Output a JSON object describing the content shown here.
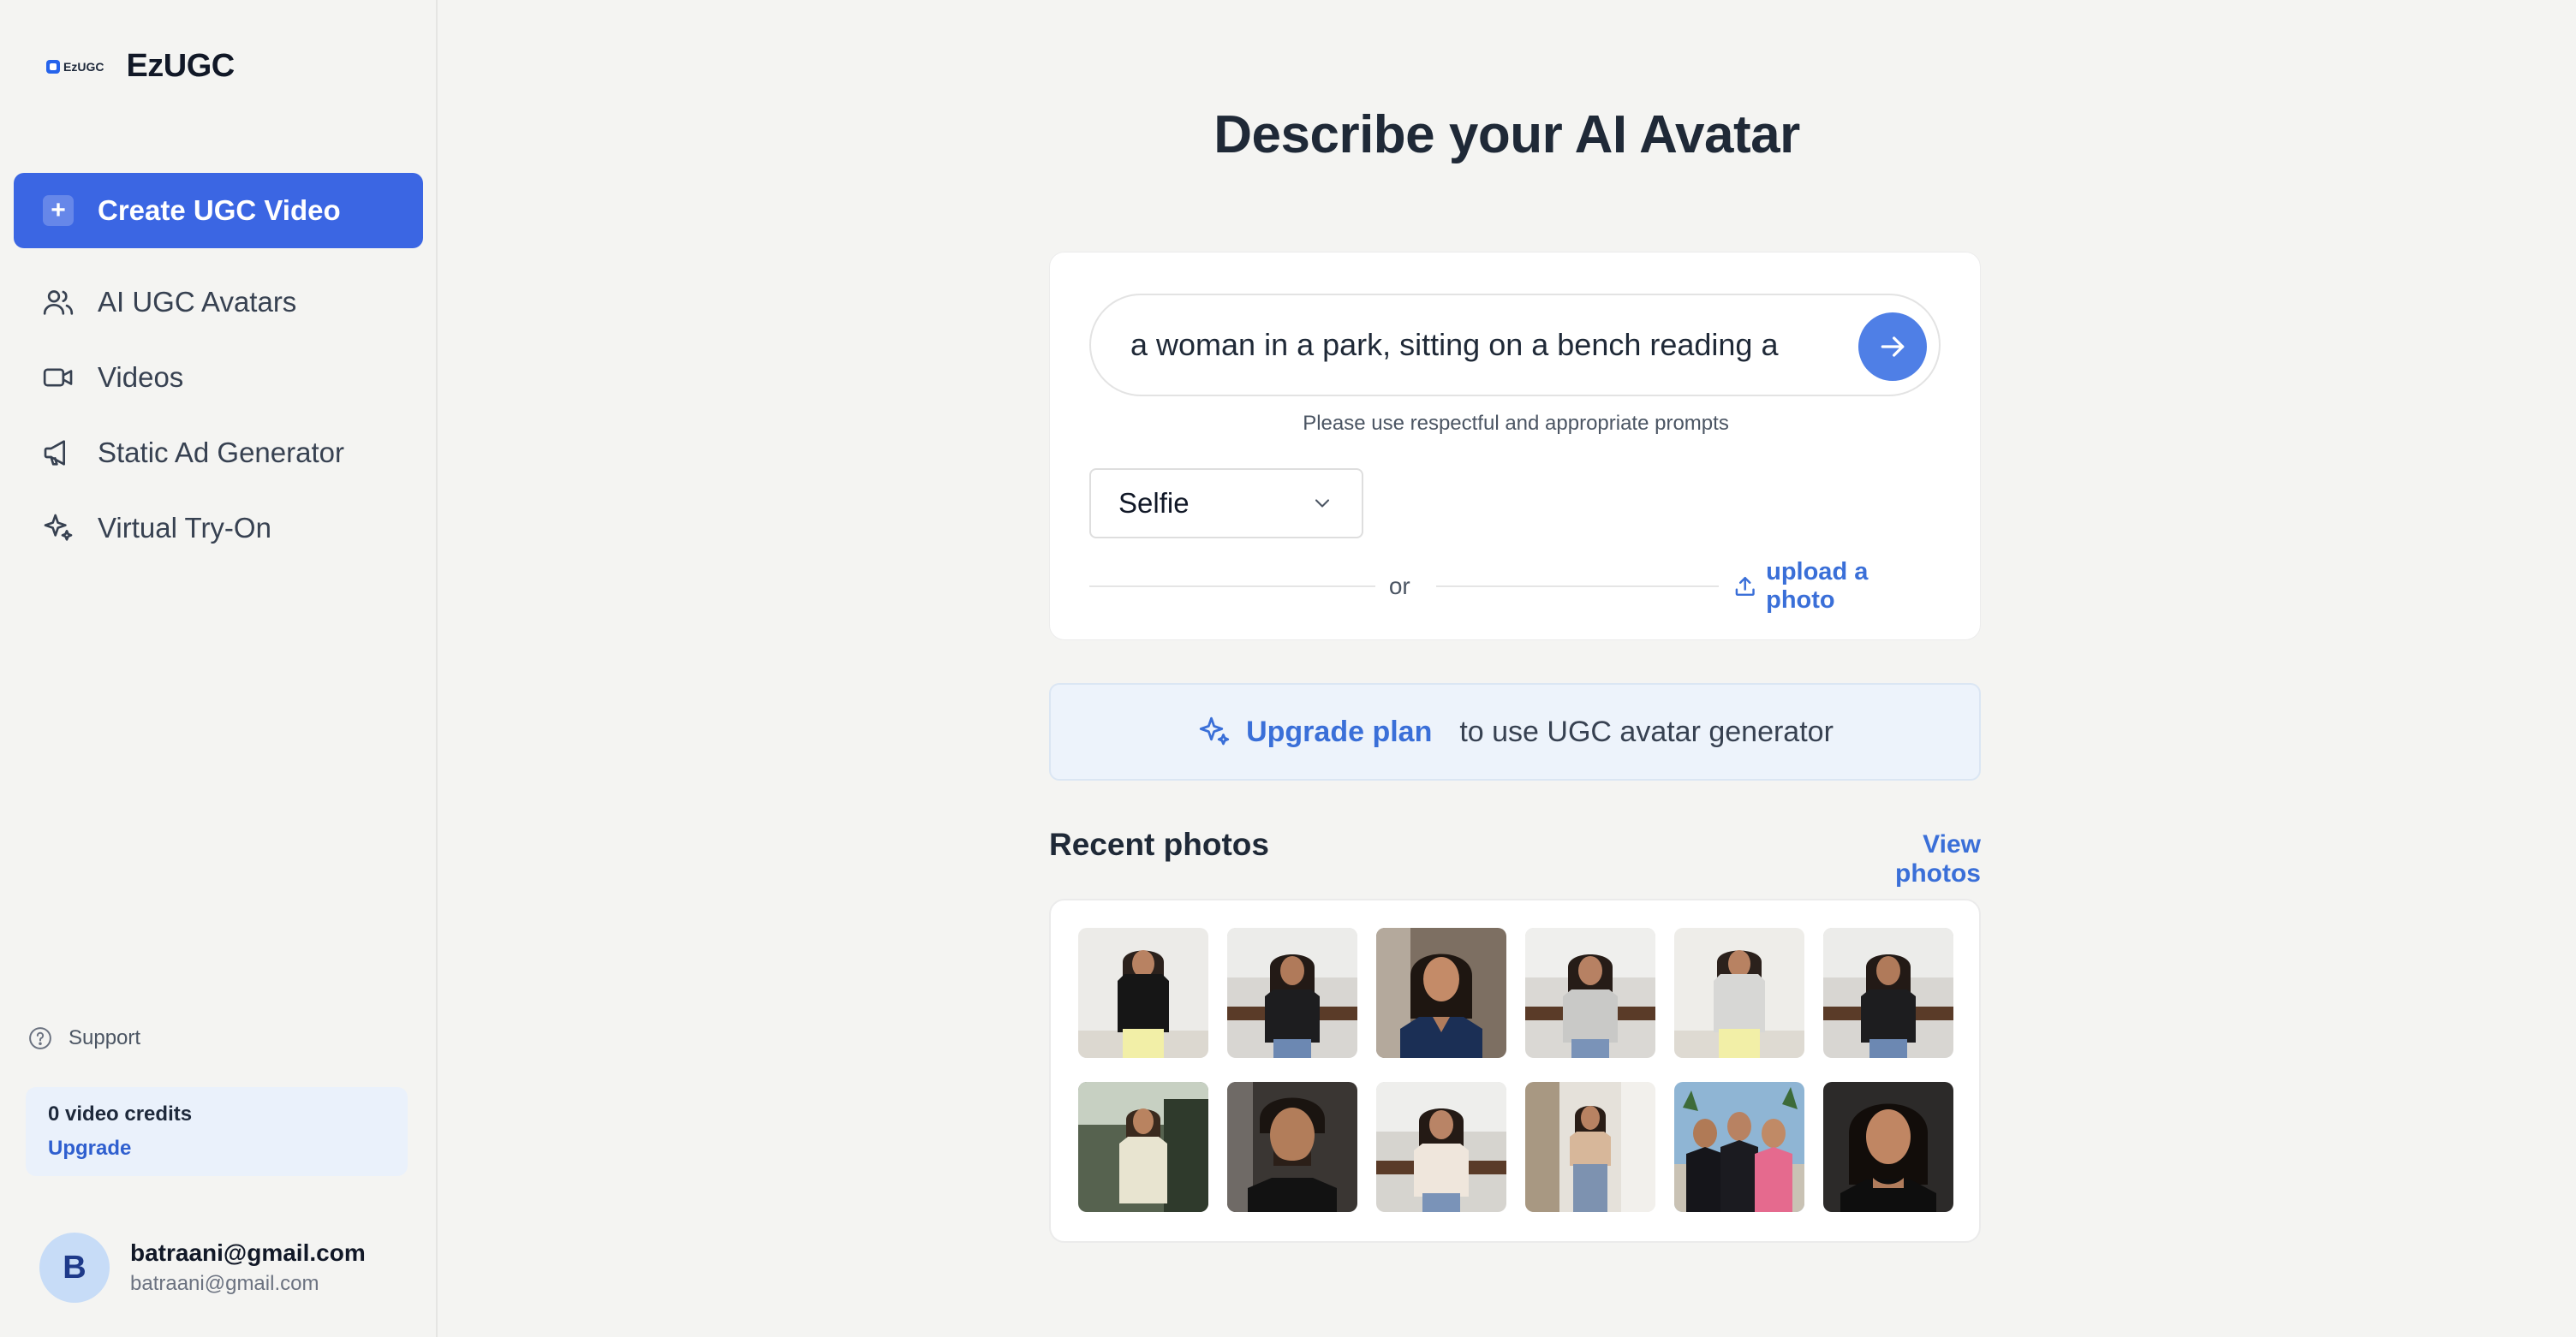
{
  "brand": {
    "logo_text": "EzUGC",
    "name": "EzUGC"
  },
  "sidebar": {
    "create_label": "Create UGC Video",
    "items": [
      {
        "label": "AI UGC Avatars",
        "icon": "users-icon"
      },
      {
        "label": "Videos",
        "icon": "video-camera-icon"
      },
      {
        "label": "Static Ad Generator",
        "icon": "megaphone-icon"
      },
      {
        "label": "Virtual Try-On",
        "icon": "sparkles-icon"
      }
    ],
    "support_label": "Support",
    "credits": {
      "text": "0 video credits",
      "upgrade": "Upgrade"
    },
    "user": {
      "initial": "B",
      "name": "batraani@gmail.com",
      "email": "batraani@gmail.com"
    }
  },
  "main": {
    "title": "Describe your AI Avatar",
    "prompt": {
      "value": "a woman in a park, sitting on a bench reading a"
    },
    "hint": "Please use respectful and appropriate prompts",
    "style_select": {
      "value": "Selfie"
    },
    "or_text": "or",
    "upload_label": "upload a photo",
    "upgrade_banner": {
      "link": "Upgrade plan",
      "rest": "to use UGC avatar generator"
    },
    "recent": {
      "title": "Recent photos",
      "view_label": "View photos"
    }
  },
  "colors": {
    "accent": "#3b66e3",
    "link": "#3a6fd8",
    "banner_bg": "#edf3fb",
    "page_bg": "#f4f4f2"
  }
}
